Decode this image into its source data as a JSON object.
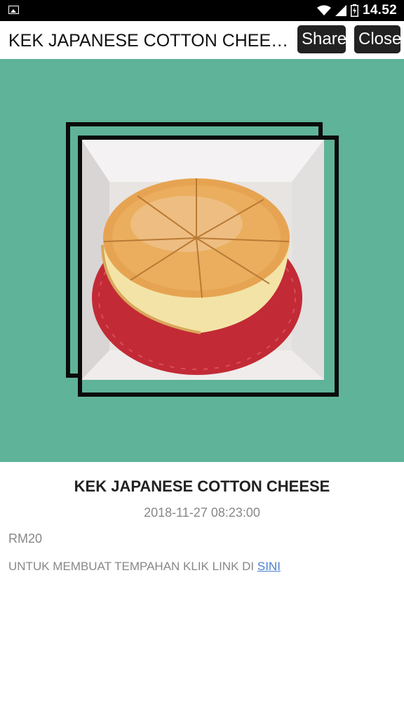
{
  "status_bar": {
    "time": "14.52",
    "icons": [
      "gallery-icon",
      "wifi-icon",
      "signal-icon",
      "battery-charging-icon"
    ]
  },
  "app_bar": {
    "title": "KEK JAPANESE COTTON CHEES..",
    "share_label": "Share",
    "close_label": "Close"
  },
  "hero": {
    "background": "#5fb398",
    "image": "cheesecake-photo"
  },
  "post": {
    "title": "KEK JAPANESE COTTON CHEESE",
    "date": "2018-11-27 08:23:00",
    "price": "RM20",
    "description": "UNTUK MEMBUAT TEMPAHAN KLIK LINK DI",
    "link_text": "SINI"
  },
  "colors": {
    "hero_bg": "#5fb398",
    "button_bg": "#222222",
    "link": "#4a7fd0"
  }
}
